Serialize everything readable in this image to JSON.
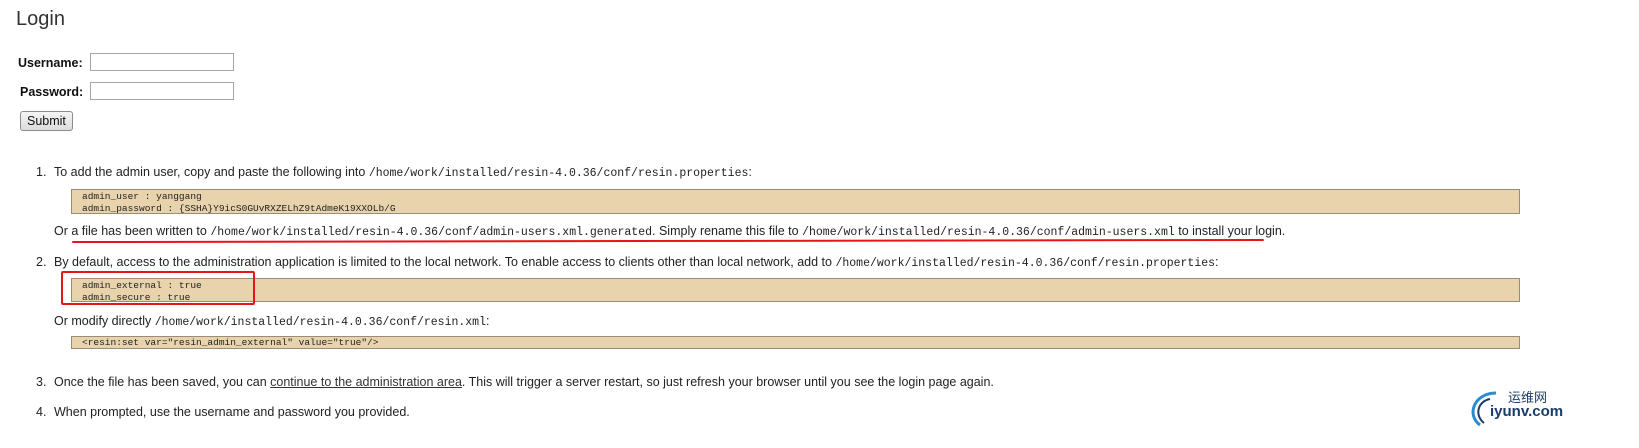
{
  "page": {
    "title": "Login"
  },
  "form": {
    "username_label": "Username:",
    "password_label": "Password:",
    "username_value": "",
    "password_value": "",
    "submit_label": "Submit"
  },
  "steps": [
    {
      "number": "1.",
      "text": "To add the admin user, copy and paste the following into",
      "path": "/home/work/installed/resin-4.0.36/conf/resin.properties",
      "suffix": ":",
      "code": [
        "admin_user : yanggang",
        "admin_password : {SSHA}Y9icS0GUvRXZELhZ9tAdmeK19XXOLb/G"
      ],
      "alt": {
        "prefix": "Or a file has been written to",
        "path1": "/home/work/installed/resin-4.0.36/conf/admin-users.xml.generated",
        "middle": ". Simply rename this file to",
        "path2": "/home/work/installed/resin-4.0.36/conf/admin-users.xml",
        "suffix": "to install your login."
      }
    },
    {
      "number": "2.",
      "text": "By default, access to the administration application is limited to the local network. To enable access to clients other than local network, add to",
      "path": "/home/work/installed/resin-4.0.36/conf/resin.properties",
      "suffix": ":",
      "code": [
        "admin_external : true",
        "admin_secure : true"
      ],
      "modify_prefix": "Or modify directly",
      "modify_path": "/home/work/installed/resin-4.0.36/conf/resin.xml",
      "modify_suffix": ":",
      "code2": "<resin:set var=\"resin_admin_external\" value=\"true\"/>"
    },
    {
      "number": "3.",
      "prefix": "Once the file has been saved, you can",
      "link": "continue to the administration area",
      "suffix": ". This will trigger a server restart, so just refresh your browser until you see the login page again."
    },
    {
      "number": "4.",
      "text": "When prompted, use the username and password you provided."
    }
  ],
  "watermark": {
    "cn": "运维网",
    "en": "iyunv.com"
  },
  "colors": {
    "code_background": "#e8d3ad",
    "annotation_red": "#e8141a",
    "watermark_blue": "#1a3c6b"
  }
}
